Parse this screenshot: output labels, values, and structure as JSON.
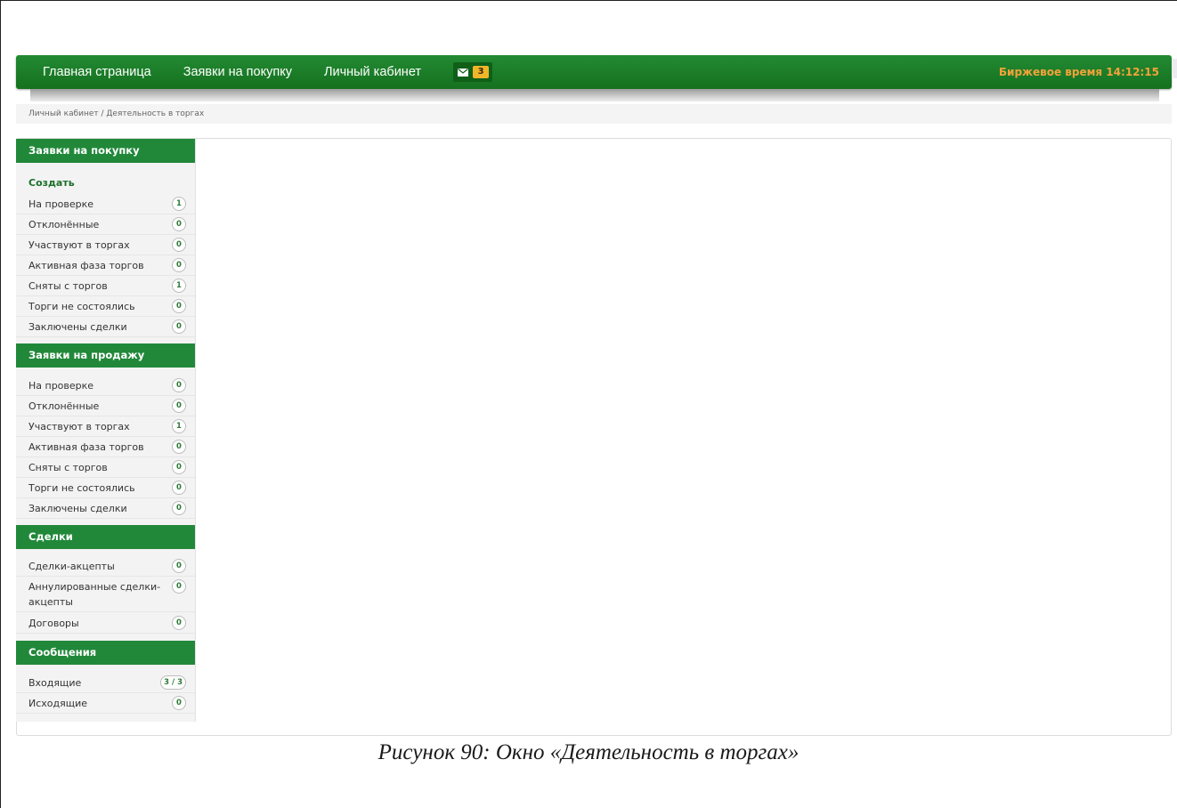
{
  "nav": {
    "items": [
      "Главная страница",
      "Заявки на покупку",
      "Личный кабинет"
    ],
    "mail_count": "3",
    "exchange_time_label": "Биржевое время 14:12:15"
  },
  "breadcrumb": "Личный кабинет / Деятельность в торгах",
  "sidebar": {
    "buy": {
      "title": "Заявки на покупку",
      "create": "Создать",
      "items": [
        {
          "label": "На проверке",
          "count": "1"
        },
        {
          "label": "Отклонённые",
          "count": "0"
        },
        {
          "label": "Участвуют в торгах",
          "count": "0"
        },
        {
          "label": "Активная фаза торгов",
          "count": "0"
        },
        {
          "label": "Сняты с торгов",
          "count": "1"
        },
        {
          "label": "Торги не состоялись",
          "count": "0"
        },
        {
          "label": "Заключены сделки",
          "count": "0"
        }
      ]
    },
    "sell": {
      "title": "Заявки на продажу",
      "items": [
        {
          "label": "На проверке",
          "count": "0"
        },
        {
          "label": "Отклонённые",
          "count": "0"
        },
        {
          "label": "Участвуют в торгах",
          "count": "1"
        },
        {
          "label": "Активная фаза торгов",
          "count": "0"
        },
        {
          "label": "Сняты с торгов",
          "count": "0"
        },
        {
          "label": "Торги не состоялись",
          "count": "0"
        },
        {
          "label": "Заключены сделки",
          "count": "0"
        }
      ]
    },
    "deals": {
      "title": "Сделки",
      "items": [
        {
          "label": "Сделки-акцепты",
          "count": "0"
        },
        {
          "label": "Аннулированные сделки-",
          "count": "0"
        },
        {
          "label": "акцепты",
          "count": ""
        },
        {
          "label": "Договоры",
          "count": "0"
        }
      ]
    },
    "messages": {
      "title": "Сообщения",
      "items": [
        {
          "label": "Входящие",
          "count": "3 / 3"
        },
        {
          "label": "Исходящие",
          "count": "0"
        }
      ]
    }
  },
  "caption": "Рисунок 90: Окно «Деятельность в торгах»"
}
